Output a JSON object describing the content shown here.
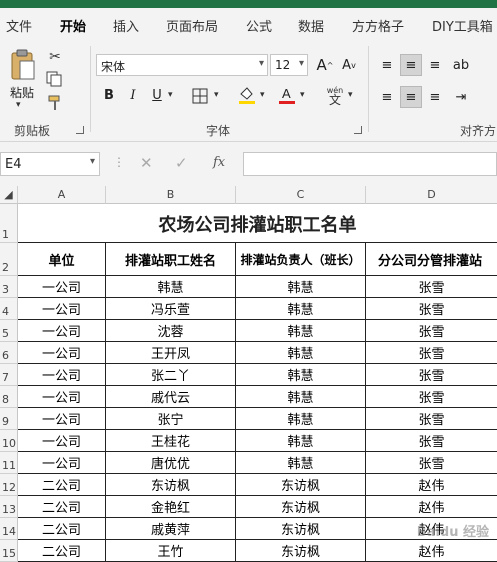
{
  "menu": {
    "tabs": [
      "文件",
      "开始",
      "插入",
      "页面布局",
      "公式",
      "数据",
      "方方格子",
      "DIY工具箱"
    ],
    "active_tab": "开始"
  },
  "ribbon": {
    "clipboard": {
      "paste_label": "粘贴",
      "group_label": "剪贴板"
    },
    "font": {
      "font_name": "宋体",
      "font_size": "12",
      "bold": "B",
      "italic": "I",
      "underline": "U",
      "phonetic": "wén",
      "group_label": "字体",
      "fill_color": "#ffd700",
      "font_color": "#e02020"
    },
    "alignment": {
      "group_label": "对齐方"
    }
  },
  "formula_bar": {
    "cell_ref": "E4",
    "fx": "fx",
    "value": ""
  },
  "sheet": {
    "columns": [
      "A",
      "B",
      "C",
      "D"
    ],
    "title": "农场公司排灌站职工名单",
    "headers": [
      "单位",
      "排灌站职工姓名",
      "排灌站负责人（班长）",
      "分公司分管排灌站"
    ],
    "rows": [
      [
        "一公司",
        "韩慧",
        "韩慧",
        "张雪"
      ],
      [
        "一公司",
        "冯乐萱",
        "韩慧",
        "张雪"
      ],
      [
        "一公司",
        "沈蓉",
        "韩慧",
        "张雪"
      ],
      [
        "一公司",
        "王开凤",
        "韩慧",
        "张雪"
      ],
      [
        "一公司",
        "张二丫",
        "韩慧",
        "张雪"
      ],
      [
        "一公司",
        "戚代云",
        "韩慧",
        "张雪"
      ],
      [
        "一公司",
        "张宁",
        "韩慧",
        "张雪"
      ],
      [
        "一公司",
        "王桂花",
        "韩慧",
        "张雪"
      ],
      [
        "一公司",
        "唐优优",
        "韩慧",
        "张雪"
      ],
      [
        "二公司",
        "东访枫",
        "东访枫",
        "赵伟"
      ],
      [
        "二公司",
        "金艳红",
        "东访枫",
        "赵伟"
      ],
      [
        "二公司",
        "戚黄萍",
        "东访枫",
        "赵伟"
      ],
      [
        "二公司",
        "王竹",
        "东访枫",
        "赵伟"
      ]
    ],
    "row_numbers": [
      "1",
      "2",
      "3",
      "4",
      "5",
      "6",
      "7",
      "8",
      "9",
      "10",
      "11",
      "12",
      "13",
      "14",
      "15"
    ]
  },
  "watermark": "Baidu 经验"
}
